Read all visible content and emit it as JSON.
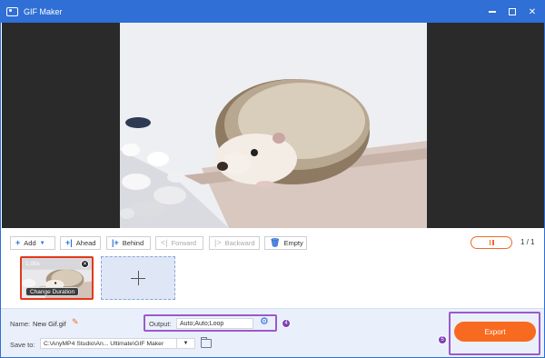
{
  "window": {
    "title": "GIF Maker",
    "accent": "#2f6fd6",
    "controls": [
      "minimize-icon",
      "maximize-icon",
      "close-icon"
    ]
  },
  "toolbar": {
    "add_label": "Add",
    "ahead_label": "Ahead",
    "behind_label": "Behind",
    "forward_label": "Forward",
    "backward_label": "Backward",
    "empty_label": "Empty",
    "page_indicator": "1 / 1"
  },
  "frames": [
    {
      "duration": "1.00s",
      "change_duration_label": "Change Duration"
    }
  ],
  "settings": {
    "name_label": "Name:",
    "name_value": "New Gif.gif",
    "output_label": "Output:",
    "output_value": "Auto;Auto;Loop",
    "save_to_label": "Save to:",
    "save_to_value": "C:\\AnyMP4 Studio\\An... Ultimate\\GIF Maker",
    "output_step": "4",
    "export_step": "5",
    "export_label": "Export",
    "export_color": "#f86a1f",
    "highlight_color": "#9b5ac9"
  }
}
